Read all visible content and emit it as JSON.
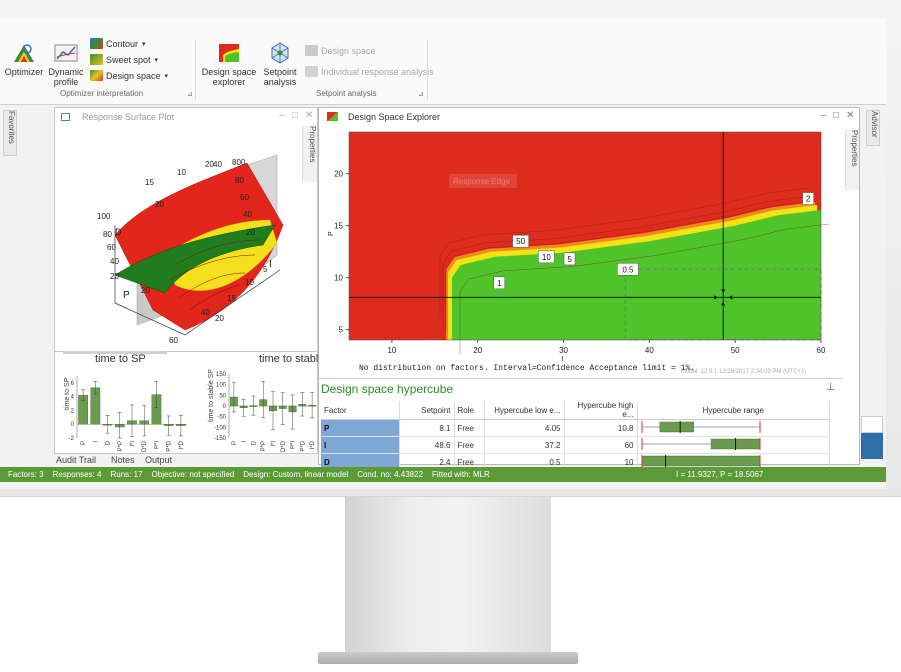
{
  "ribbon": {
    "optimizer": "Optimizer",
    "dynamic_profile": "Dynamic profile",
    "contour": "Contour",
    "sweet_spot": "Sweet spot",
    "design_space": "Design space",
    "design_space_explorer": "Design space explorer",
    "setpoint_analysis": "Setpoint analysis",
    "design_space_disabled": "Design space",
    "individual_response_analysis": "Individual response analysis",
    "group_optimizer_interpretation": "Optimizer interpretation",
    "group_setpoint_analysis": "Setpoint analysis"
  },
  "side_tabs": {
    "favorites": "Favorites",
    "advisor": "Advisor",
    "properties": "Properties"
  },
  "response_surface": {
    "title": "Response Surface Plot",
    "axis_labels": {
      "p": "P",
      "i": "I",
      "d": "D"
    },
    "p_ticks": [
      "100",
      "80",
      "60",
      "40",
      "20",
      "20"
    ],
    "i_ticks": [
      "5",
      "10",
      "15",
      "20"
    ],
    "top_ticks": [
      "15",
      "10",
      "20",
      "40"
    ],
    "z_ticks": [
      "800",
      "80",
      "60",
      "40",
      "20"
    ],
    "back_ticks": [
      "20",
      "20"
    ],
    "bottom_ticks": [
      "40",
      "60"
    ]
  },
  "design_space_explorer": {
    "title": "Design Space Explorer",
    "footer_note": "No distribution on factors. Interval=Confidence Acceptance limit = 1%.",
    "model_stamp": "Model: 12.0.1   12/18/2017 2:34:03 PM (UTC+1)",
    "colors": {
      "fail": "#dd2b1d",
      "pass": "#4fc32a",
      "edge": "#f2e313"
    }
  },
  "chart_data": [
    {
      "type": "heatmap",
      "title": "",
      "xlabel": "I",
      "ylabel": "P",
      "xlim": [
        5,
        60
      ],
      "ylim": [
        4,
        24
      ],
      "x_ticks": [
        10,
        20,
        30,
        40,
        50,
        60
      ],
      "y_ticks": [
        5,
        10,
        15,
        20
      ],
      "crosshair": {
        "I": 48.6,
        "P": 8.1
      },
      "hypercube": {
        "I": [
          37.2,
          60
        ],
        "P": [
          4.05,
          10.8
        ]
      },
      "region_boundary": [
        [
          17,
          4
        ],
        [
          17,
          10
        ],
        [
          18,
          11.2
        ],
        [
          22,
          12
        ],
        [
          30,
          12.4
        ],
        [
          40,
          13.5
        ],
        [
          50,
          15
        ],
        [
          55,
          16
        ],
        [
          60,
          16.5
        ]
      ],
      "contour_labels": [
        {
          "text": "50",
          "I": 25,
          "P": 13.5
        },
        {
          "text": "10",
          "I": 28,
          "P": 12
        },
        {
          "text": "5",
          "I": 30.7,
          "P": 11.8
        },
        {
          "text": "1",
          "I": 22.5,
          "P": 9.5
        },
        {
          "text": "0.5",
          "I": 37.5,
          "P": 10.8
        },
        {
          "text": "2",
          "I": 58.5,
          "P": 17.6
        }
      ],
      "ghost_labels": [
        "Response Edge"
      ]
    },
    {
      "type": "bar",
      "title": "time to SP",
      "ylabel": "time to SP",
      "ylim": [
        -2,
        7
      ],
      "y_ticks": [
        -2,
        0,
        2,
        4,
        6
      ],
      "categories": [
        "P",
        "I",
        "D",
        "P*P",
        "I*I",
        "D*D",
        "P*I",
        "P*D",
        "I*D"
      ],
      "values": [
        4.2,
        5.3,
        0,
        -0.4,
        0.5,
        0.5,
        4.3,
        -0.2,
        -0.2
      ],
      "error": [
        0.8,
        0.9,
        1.3,
        2.1,
        2.3,
        2.2,
        1.9,
        1.4,
        1.5
      ]
    },
    {
      "type": "bar",
      "title": "time to stable SP",
      "ylabel": "time to stable SP",
      "ylim": [
        -150,
        150
      ],
      "y_ticks": [
        -150,
        -100,
        -50,
        0,
        50,
        100,
        150
      ],
      "categories": [
        "P",
        "I",
        "D",
        "P*P",
        "I*I",
        "D*D",
        "P*I",
        "P*D",
        "I*D"
      ],
      "values": [
        42,
        -8,
        2,
        30,
        -22,
        -12,
        -28,
        8,
        4
      ],
      "error": [
        70,
        40,
        45,
        85,
        90,
        75,
        80,
        55,
        60
      ]
    }
  ],
  "hypercube": {
    "title": "Design space hypercube",
    "pin": "↑",
    "headers": [
      "Factor",
      "Setpoint",
      "Role",
      "Hypercube low e...",
      "Hypercube high e...",
      "Hypercube range"
    ],
    "rows": [
      {
        "factor": "P",
        "setpoint": "8.1",
        "role": "Free",
        "low": "4.05",
        "high": "10.8",
        "range_min": 0.5,
        "range_max": 24,
        "lo": 4.05,
        "hi": 10.8,
        "sp": 8.1
      },
      {
        "factor": "I",
        "setpoint": "48.6",
        "role": "Free",
        "low": "37.2",
        "high": "60",
        "range_min": 5,
        "range_max": 60,
        "lo": 37.2,
        "hi": 60,
        "sp": 48.6
      },
      {
        "factor": "D",
        "setpoint": "2.4",
        "role": "Free",
        "low": "0.5",
        "high": "10",
        "range_min": 0.5,
        "range_max": 10,
        "lo": 0.5,
        "hi": 10,
        "sp": 2.4
      }
    ]
  },
  "tabs": [
    "Audit Trail",
    "Notes",
    "Output"
  ],
  "status": {
    "factors": "Factors: 3",
    "responses": "Responses: 4",
    "runs": "Runs: 17",
    "objective": "Objective: not specified",
    "design": "Design: Custom, linear model",
    "cond": "Cond. no: 4.43822",
    "fitted": "Fitted with: MLR",
    "coords": "I = 11.9327, P = 18.5067"
  }
}
